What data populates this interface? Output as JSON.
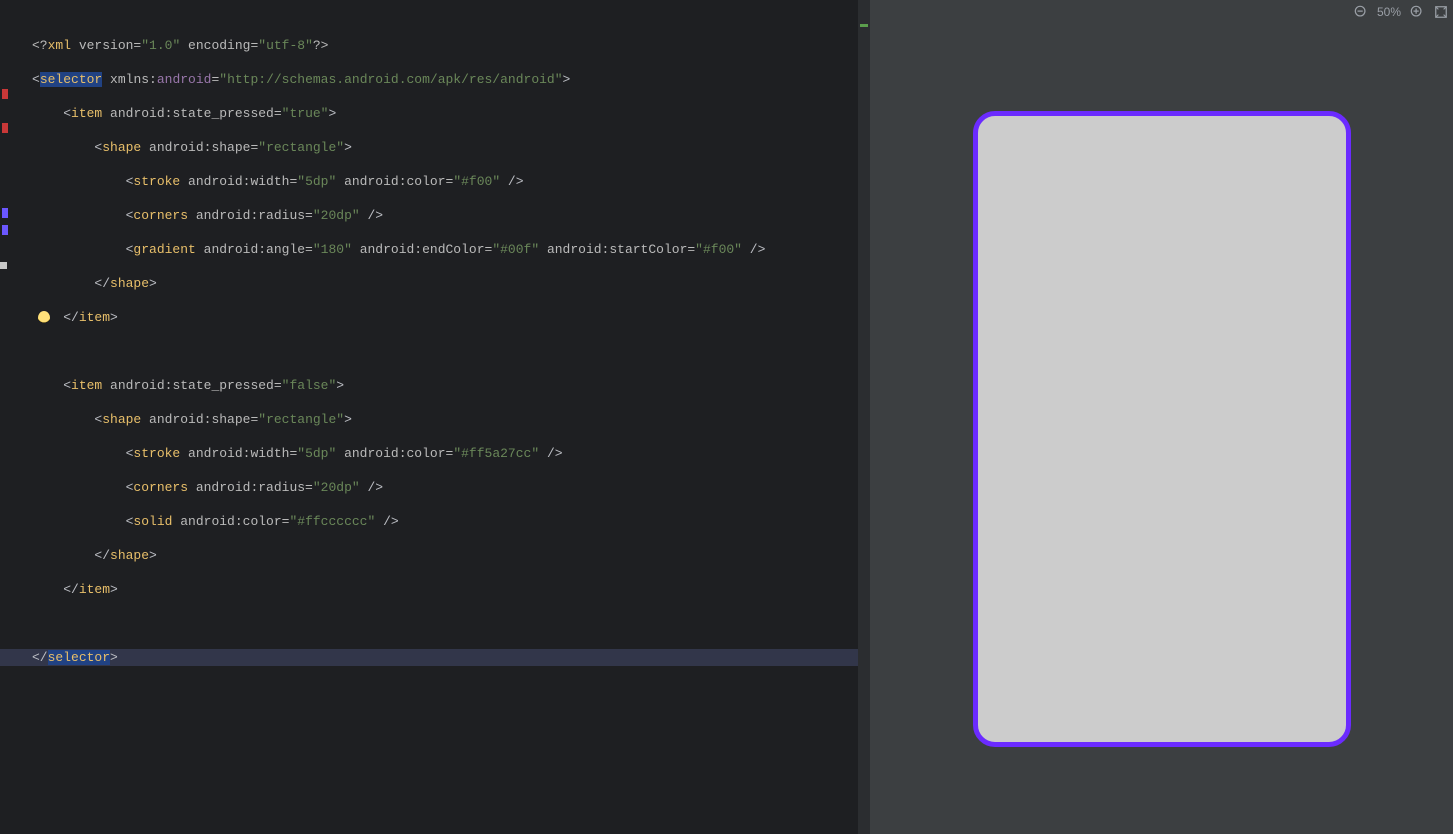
{
  "toolbar": {
    "zoom_label": "50%"
  },
  "code": {
    "l1_a": "<?",
    "l1_b": "xml",
    "l1_c": " version=",
    "l1_d": "\"1.0\"",
    "l1_e": " encoding=",
    "l1_f": "\"utf-8\"",
    "l1_g": "?>",
    "l2_a": "<",
    "l2_b": "selector",
    "l2_c": " xmlns:",
    "l2_d": "android",
    "l2_e": "=",
    "l2_f": "\"http://schemas.android.com/apk/res/android\"",
    "l2_g": ">",
    "l3_a": "    <",
    "l3_b": "item",
    "l3_c": " android:state_pressed=",
    "l3_d": "\"true\"",
    "l3_e": ">",
    "l4_a": "        <",
    "l4_b": "shape",
    "l4_c": " android:shape=",
    "l4_d": "\"rectangle\"",
    "l4_e": ">",
    "l5_a": "            <",
    "l5_b": "stroke",
    "l5_c": " android:width=",
    "l5_d": "\"5dp\"",
    "l5_e": " android:color=",
    "l5_f": "\"#f00\"",
    "l5_g": " />",
    "l6_a": "            <",
    "l6_b": "corners",
    "l6_c": " android:radius=",
    "l6_d": "\"20dp\"",
    "l6_e": " />",
    "l7_a": "            <",
    "l7_b": "gradient",
    "l7_c": " android:angle=",
    "l7_d": "\"180\"",
    "l7_e": " android:endColor=",
    "l7_f": "\"#00f\"",
    "l7_g": " android:startColor=",
    "l7_h": "\"#f00\"",
    "l7_i": " />",
    "l8_a": "        </",
    "l8_b": "shape",
    "l8_c": ">",
    "l9_a": "    </",
    "l9_b": "item",
    "l9_c": ">",
    "l10": "",
    "l11_a": "    <",
    "l11_b": "item",
    "l11_c": " android:state_pressed=",
    "l11_d": "\"false\"",
    "l11_e": ">",
    "l12_a": "        <",
    "l12_b": "shape",
    "l12_c": " android:shape=",
    "l12_d": "\"rectangle\"",
    "l12_e": ">",
    "l13_a": "            <",
    "l13_b": "stroke",
    "l13_c": " android:width=",
    "l13_d": "\"5dp\"",
    "l13_e": " android:color=",
    "l13_f": "\"#ff5a27cc\"",
    "l13_g": " />",
    "l14_a": "            <",
    "l14_b": "corners",
    "l14_c": " android:radius=",
    "l14_d": "\"20dp\"",
    "l14_e": " />",
    "l15_a": "            <",
    "l15_b": "solid",
    "l15_c": " android:color=",
    "l15_d": "\"#ffcccccc\"",
    "l15_e": " />",
    "l16_a": "        </",
    "l16_b": "shape",
    "l16_c": ">",
    "l17_a": "    </",
    "l17_b": "item",
    "l17_c": ">",
    "l18": "",
    "l19_a": "</",
    "l19_b": "selector",
    "l19_c": ">"
  },
  "preview": {
    "stroke_color": "#6b2bff",
    "fill_color": "#cccccc",
    "stroke_width": "5",
    "corner_radius": "22"
  }
}
